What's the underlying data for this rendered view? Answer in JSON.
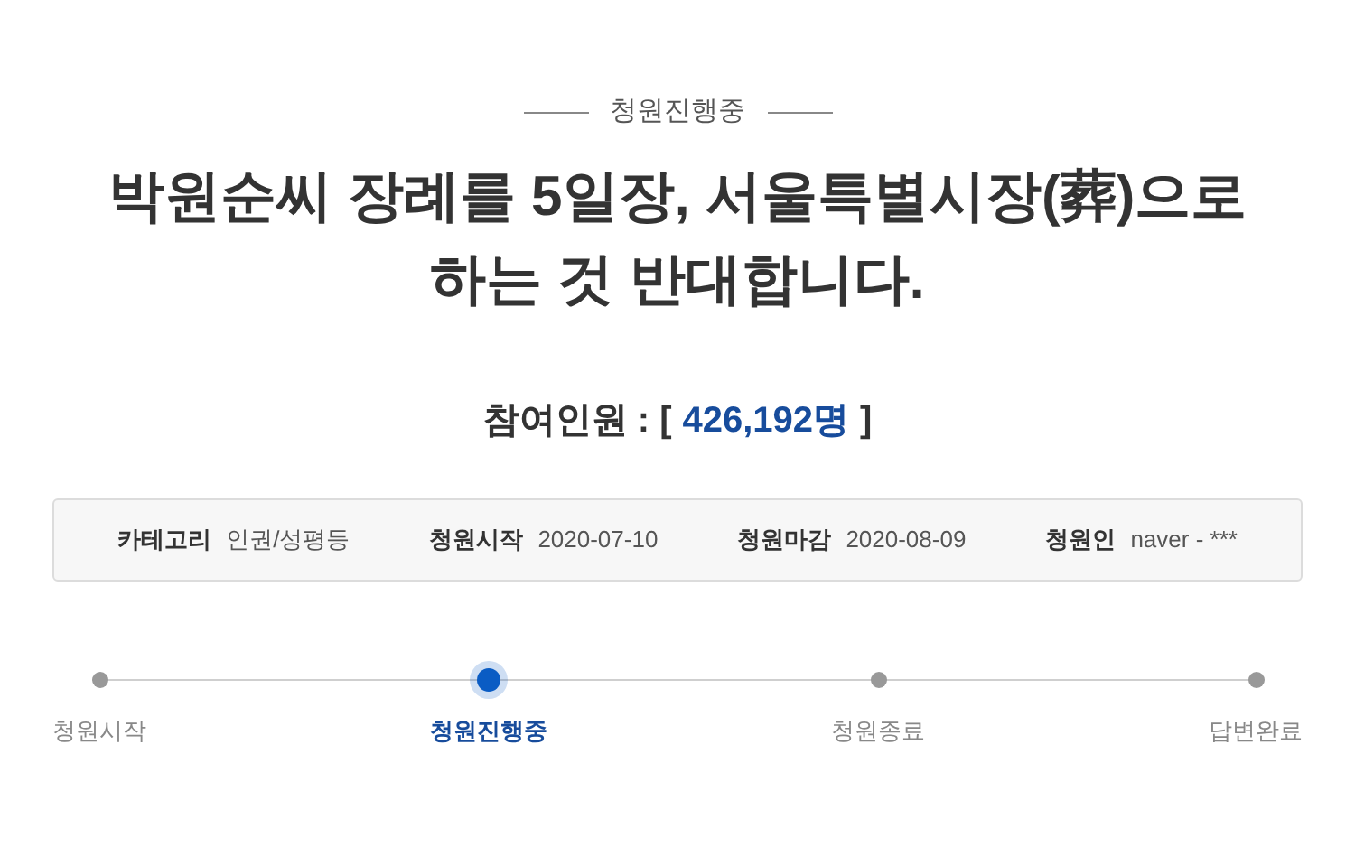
{
  "status_label": "청원진행중",
  "title_lines": [
    "박원순씨 장례를 5일장, 서울특별시장(葬)으로",
    "하는 것 반대합니다."
  ],
  "participants": {
    "label": "참여인원 : [",
    "count": "426,192명",
    "close": "]"
  },
  "info": [
    {
      "label": "카테고리",
      "value": "인권/성평등"
    },
    {
      "label": "청원시작",
      "value": "2020-07-10"
    },
    {
      "label": "청원마감",
      "value": "2020-08-09"
    },
    {
      "label": "청원인",
      "value": "naver - ***"
    }
  ],
  "steps": [
    {
      "label": "청원시작",
      "selected": false
    },
    {
      "label": "청원진행중",
      "selected": true
    },
    {
      "label": "청원종료",
      "selected": false
    },
    {
      "label": "답변완료",
      "selected": false
    }
  ]
}
